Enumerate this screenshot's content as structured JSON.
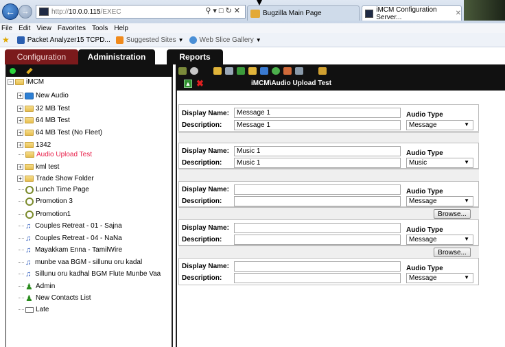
{
  "browser": {
    "url_host": "10.0.0.115",
    "url_prefix": "http://",
    "url_suffix": "/EXEC",
    "tabs": [
      {
        "label": "Bugzilla Main Page"
      },
      {
        "label": "iMCM Configuration Server..."
      }
    ],
    "menu": [
      "File",
      "Edit",
      "View",
      "Favorites",
      "Tools",
      "Help"
    ],
    "favorites": [
      {
        "label": "Packet Analyzer15 TCPD..."
      },
      {
        "label": "Suggested Sites"
      },
      {
        "label": "Web Slice Gallery"
      }
    ]
  },
  "app": {
    "tabs": {
      "configuration": "Configuration",
      "administration": "Administration",
      "reports": "Reports"
    },
    "content_title": "iMCM\\Audio Upload Test"
  },
  "tree": {
    "root": "iMCM",
    "items": [
      {
        "label": "New Audio",
        "icon": "blue-folder-icon"
      },
      {
        "label": "32 MB Test",
        "icon": "folder-icon"
      },
      {
        "label": "64 MB Test",
        "icon": "folder-icon"
      },
      {
        "label": "64 MB Test (No Fleet)",
        "icon": "folder-icon"
      },
      {
        "label": "1342",
        "icon": "folder-icon"
      },
      {
        "label": "Audio Upload Test",
        "icon": "folder-icon",
        "selected": true
      },
      {
        "label": "kml test",
        "icon": "folder-icon"
      },
      {
        "label": "Trade Show Folder",
        "icon": "folder-icon"
      },
      {
        "label": "Lunch Time Page",
        "icon": "key-icon"
      },
      {
        "label": "Promotion 3",
        "icon": "key-icon"
      },
      {
        "label": "Promotion1",
        "icon": "key-icon"
      },
      {
        "label": "Couples Retreat - 01 - Sajna",
        "icon": "music-note-icon"
      },
      {
        "label": "Couples Retreat - 04 - NaNa",
        "icon": "music-note-icon"
      },
      {
        "label": "Mayakkam Enna - TamilWire",
        "icon": "music-note-icon"
      },
      {
        "label": "munbe vaa BGM - sillunu oru kadal",
        "icon": "music-note-icon"
      },
      {
        "label": "Sillunu oru kadhal BGM Flute Munbe Vaa",
        "icon": "music-note-icon"
      },
      {
        "label": "Admin",
        "icon": "person-icon"
      },
      {
        "label": "New Contacts List",
        "icon": "person-icon"
      },
      {
        "label": "Late",
        "icon": "mail-icon"
      }
    ]
  },
  "form": {
    "labels": {
      "display_name": "Display Name:",
      "description": "Description:",
      "audio_type": "Audio Type",
      "browse": "Browse..."
    },
    "entries": [
      {
        "display_name": "Message 1",
        "description": "Message 1",
        "audio_type": "Message"
      },
      {
        "display_name": "Music 1",
        "description": "Music 1",
        "audio_type": "Music"
      },
      {
        "display_name": "",
        "description": "",
        "audio_type": "Message"
      },
      {
        "display_name": "",
        "description": "",
        "audio_type": "Message"
      },
      {
        "display_name": "",
        "description": "",
        "audio_type": "Message"
      }
    ]
  }
}
